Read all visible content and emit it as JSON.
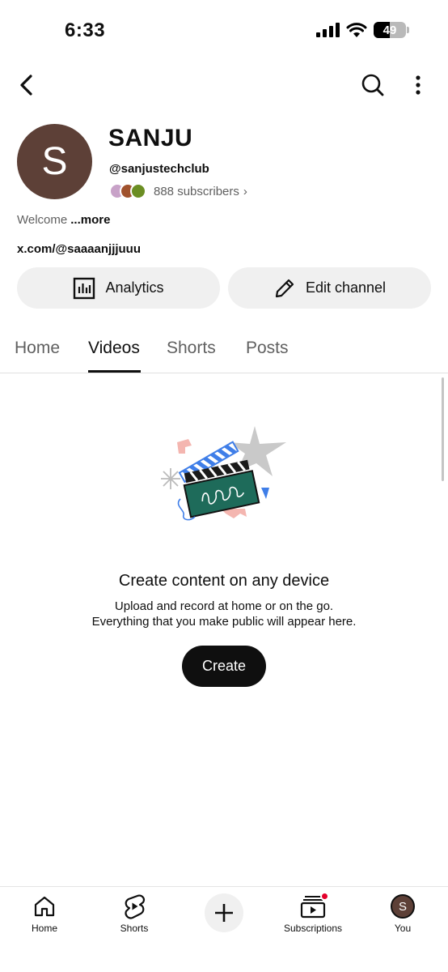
{
  "status_bar": {
    "time": "6:33",
    "battery": "49",
    "battery_level": 0.49,
    "icons": [
      "signal-icon",
      "wifi-icon",
      "battery-icon"
    ]
  },
  "top_nav": {
    "icons": [
      "back-arrow-icon",
      "search-icon",
      "more-vert-icon"
    ]
  },
  "channel": {
    "avatar_letter": "S",
    "avatar_color": "#5d4037",
    "name": "SANJU",
    "handle": "@sanjustechclub",
    "subscribers": "888 subscribers",
    "subscribers_chevron": "›",
    "description": "Welcome",
    "description_more": "...more",
    "link": "x.com/@saaaanjjjuuu"
  },
  "actions": {
    "analytics_label": "Analytics",
    "edit_label": "Edit channel",
    "analytics_icon": "analytics-icon",
    "edit_icon": "pencil-icon"
  },
  "tabs": [
    {
      "label": "Home",
      "active": false
    },
    {
      "label": "Videos",
      "active": true
    },
    {
      "label": "Shorts",
      "active": false
    },
    {
      "label": "Posts",
      "active": false
    }
  ],
  "empty_state": {
    "illustration": "clapperboard-illustration",
    "title": "Create content on any device",
    "subtitle_line1": "Upload and record at home or on the go.",
    "subtitle_line2": "Everything that you make public will appear here.",
    "create_label": "Create"
  },
  "bottom_nav": {
    "items": [
      {
        "label": "Home",
        "icon": "home-icon"
      },
      {
        "label": "Shorts",
        "icon": "shorts-icon"
      },
      {
        "label": "",
        "icon": "plus-icon"
      },
      {
        "label": "Subscriptions",
        "icon": "subscriptions-icon"
      },
      {
        "label": "You",
        "icon": "avatar"
      }
    ],
    "you_avatar_letter": "S",
    "notification_color": "#e4002b"
  },
  "colors": {
    "text_primary": "#0f0f0f",
    "text_secondary": "#606060",
    "button_bg": "#f0f0f0",
    "avatar_bg": "#5d4037"
  }
}
